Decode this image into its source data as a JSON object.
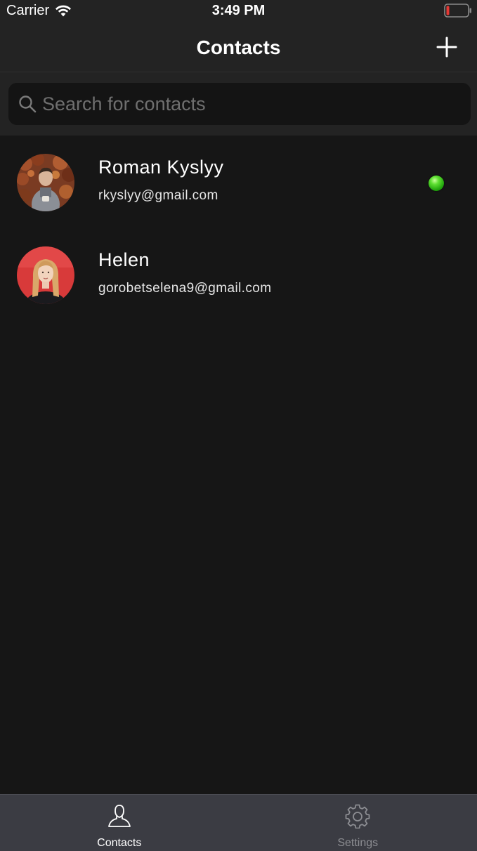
{
  "status_bar": {
    "carrier": "Carrier",
    "time": "3:49 PM",
    "battery_color": "#e53935"
  },
  "nav": {
    "title": "Contacts",
    "add_icon": "plus-icon"
  },
  "search": {
    "placeholder": "Search for contacts",
    "value": ""
  },
  "contacts": [
    {
      "name": "Roman Kyslyy",
      "email": "rkyslyy@gmail.com",
      "online": true
    },
    {
      "name": "Helen",
      "email": "gorobetselena9@gmail.com",
      "online": false
    }
  ],
  "tabs": [
    {
      "label": "Contacts",
      "icon": "person-icon",
      "active": true
    },
    {
      "label": "Settings",
      "icon": "gear-icon",
      "active": false
    }
  ],
  "colors": {
    "background": "#161616",
    "bar_background": "#232323",
    "tab_bar_background": "#3b3c43",
    "online": "#3ecf1a"
  }
}
